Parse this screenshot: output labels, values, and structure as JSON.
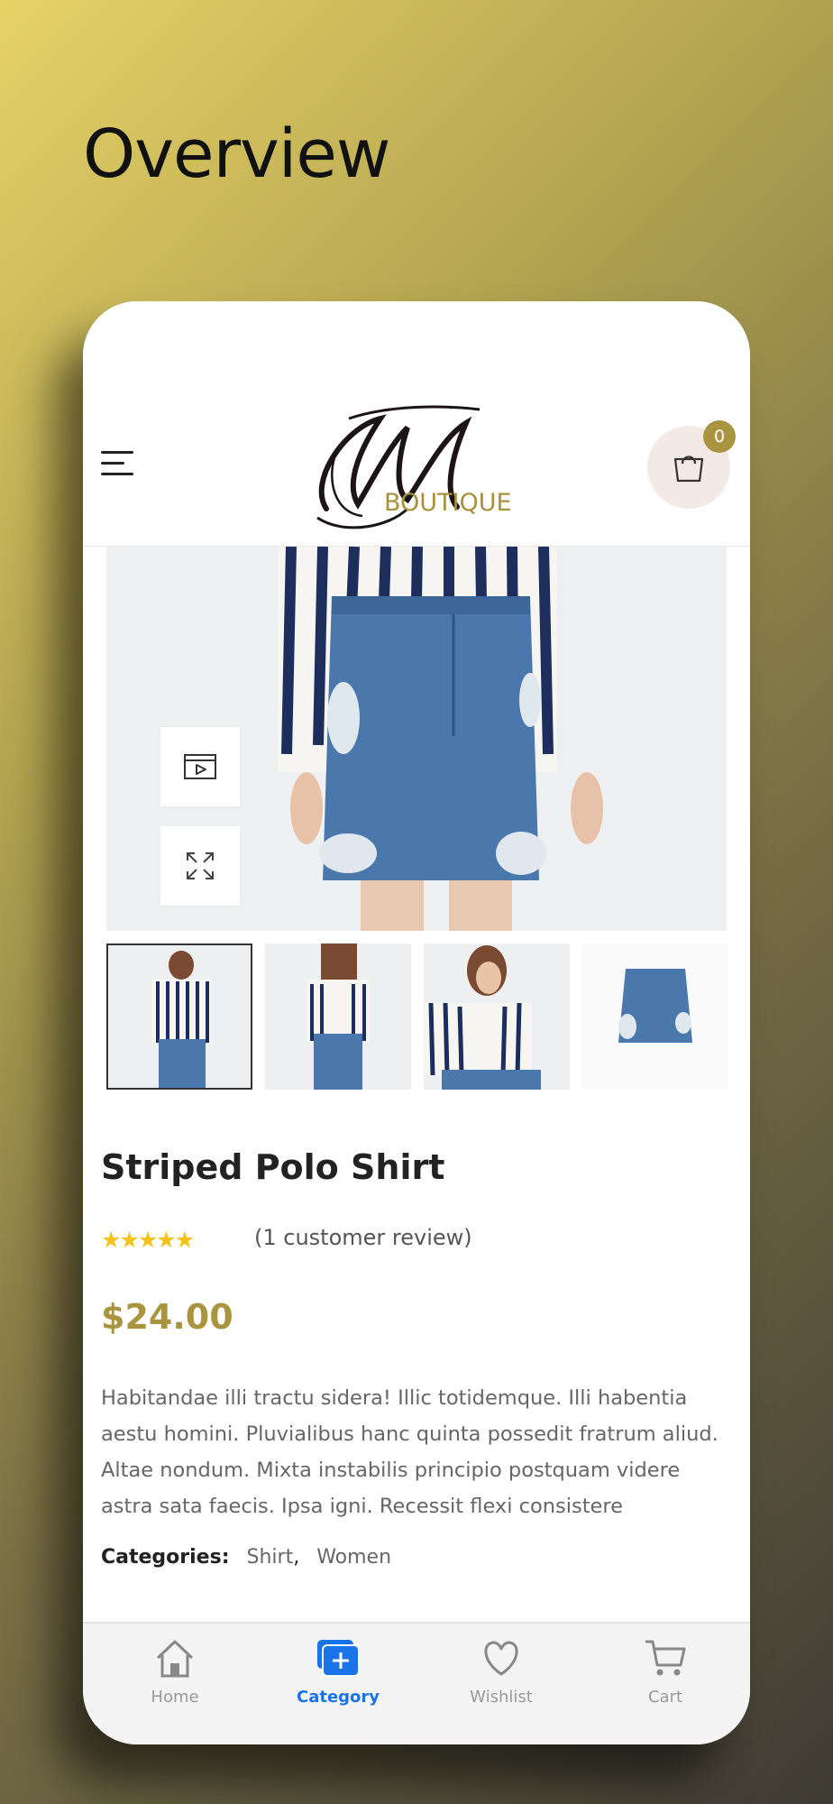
{
  "page": {
    "title": "Overview"
  },
  "header": {
    "logo_text": "BOUTIQUE",
    "cart_count": "0"
  },
  "product": {
    "name": "Striped Polo Shirt",
    "rating": 5,
    "review_text": "(1 customer review)",
    "price": "$24.00",
    "description": "Habitandae illi tractu sidera! Illic totidemque. Illi habentia aestu homini. Pluvialibus hanc quinta possedit fratrum aliud. Altae nondum. Mixta instabilis principio postquam videre astra sata faecis. Ipsa igni. Recessit flexi consistere",
    "categories_label": "Categories:",
    "categories": [
      "Shirt",
      "Women"
    ],
    "category_separator": ","
  },
  "media_tools": [
    {
      "name": "video-icon"
    },
    {
      "name": "expand-icon"
    }
  ],
  "thumbnails": [
    {
      "name": "front-view",
      "active": true
    },
    {
      "name": "back-view",
      "active": false
    },
    {
      "name": "close-view",
      "active": false
    },
    {
      "name": "skirt-only",
      "active": false
    }
  ],
  "bottom_nav": [
    {
      "label": "Home",
      "icon": "home-icon",
      "active": false
    },
    {
      "label": "Category",
      "icon": "category-icon",
      "active": true
    },
    {
      "label": "Wishlist",
      "icon": "heart-icon",
      "active": false
    },
    {
      "label": "Cart",
      "icon": "cart-icon",
      "active": false
    }
  ],
  "colors": {
    "accent": "#a99440",
    "active_nav": "#1a73e8",
    "star": "#f4c21a"
  }
}
